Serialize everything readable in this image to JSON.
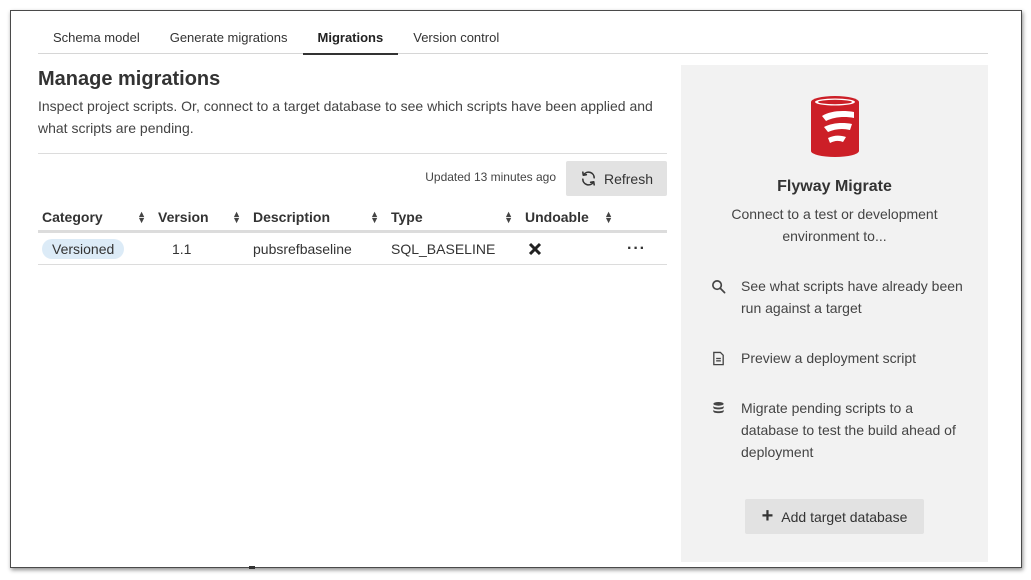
{
  "tabs": [
    {
      "label": "Schema model"
    },
    {
      "label": "Generate migrations"
    },
    {
      "label": "Migrations",
      "active": true
    },
    {
      "label": "Version control"
    }
  ],
  "main": {
    "title": "Manage migrations",
    "description": "Inspect project scripts. Or, connect to a target database to see which scripts have been applied and what scripts are pending.",
    "updated_text": "Updated 13 minutes ago",
    "refresh_label": "Refresh"
  },
  "table": {
    "columns": [
      "Category",
      "Version",
      "Description",
      "Type",
      "Undoable"
    ],
    "rows": [
      {
        "category": "Versioned",
        "version": "1.1",
        "description": "pubsrefbaseline",
        "type": "SQL_BASELINE",
        "undoable": false
      }
    ]
  },
  "panel": {
    "title": "Flyway Migrate",
    "subtitle": "Connect to a test or development environment to...",
    "features": [
      {
        "icon": "search-icon",
        "text": "See what scripts have already been run against a target"
      },
      {
        "icon": "document-icon",
        "text": "Preview a deployment script"
      },
      {
        "icon": "database-icon",
        "text": "Migrate pending scripts to a database to test the build ahead of deployment"
      }
    ],
    "add_button_label": "Add target database"
  },
  "colors": {
    "logo_red": "#cc1f27",
    "badge_bg": "#dcebf7",
    "panel_bg": "#f2f2f2",
    "button_bg": "#e2e2e2"
  }
}
